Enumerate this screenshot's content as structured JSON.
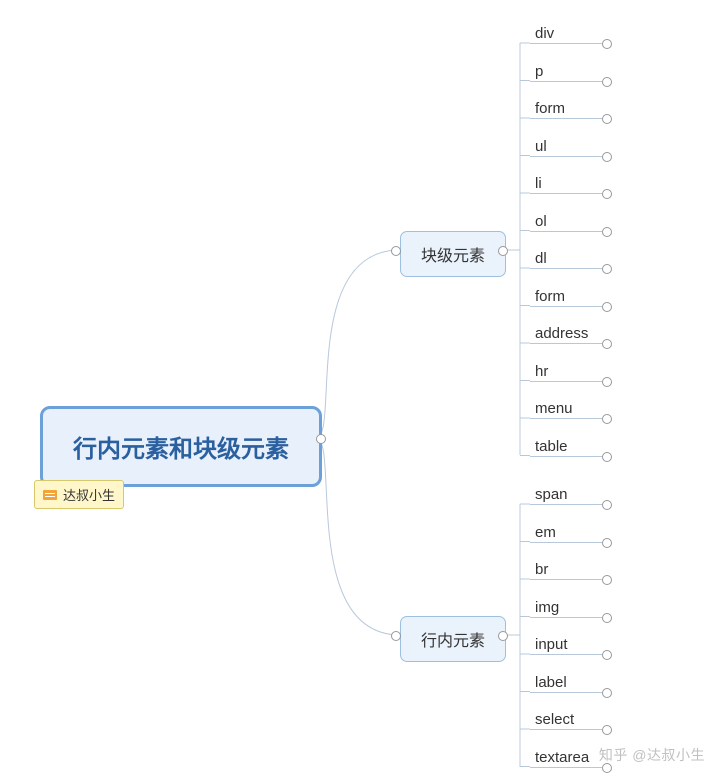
{
  "root": {
    "title": "行内元素和块级元素"
  },
  "tag": {
    "label": "达叔小生"
  },
  "branches": [
    {
      "key": "block",
      "label": "块级元素",
      "leaves": [
        "div",
        "p",
        "form",
        "ul",
        "li",
        "ol",
        "dl",
        "form",
        "address",
        "hr",
        "menu",
        "table"
      ]
    },
    {
      "key": "inline",
      "label": "行内元素",
      "leaves": [
        "span",
        "em",
        "br",
        "img",
        "input",
        "label",
        "select",
        "textarea"
      ]
    }
  ],
  "watermark": "知乎 @达叔小生"
}
